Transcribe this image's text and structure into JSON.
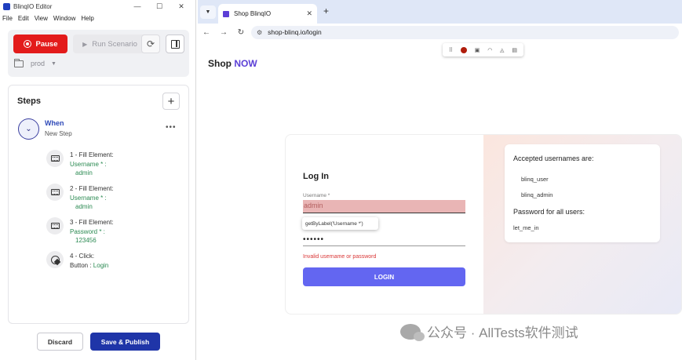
{
  "editor": {
    "title": "BlinqIO Editor",
    "window_controls": {
      "minimize": "—",
      "maximize": "☐",
      "close": "✕"
    },
    "menu": [
      "File",
      "Edit",
      "View",
      "Window",
      "Help"
    ],
    "toolbar": {
      "pause_label": "Pause",
      "run_label": "Run Scenario",
      "env_label": "prod"
    },
    "steps_title": "Steps",
    "add_step_label": "+",
    "group": {
      "keyword": "When",
      "name": "New Step",
      "more_label": "•••"
    },
    "steps": [
      {
        "line1": "1 - Fill Element:",
        "line2": "Username * :",
        "line3": "admin"
      },
      {
        "line1": "2 - Fill Element:",
        "line2": "Username * :",
        "line3": "admin"
      },
      {
        "line1": "3 - Fill Element:",
        "line2": "Password * :",
        "line3": "123456"
      },
      {
        "line1": "4 - Click:",
        "line2_prefix": "Button : ",
        "line2_value": "Login"
      }
    ],
    "footer": {
      "discard_label": "Discard",
      "save_label": "Save & Publish"
    }
  },
  "browser": {
    "tab_title": "Shop BlinqIO",
    "tab_close": "✕",
    "new_tab": "+",
    "url": "shop-blinq.io/login",
    "nav": {
      "back": "←",
      "forward": "→",
      "reload": "↻"
    },
    "recorder_icons": [
      "⠿",
      "▣",
      "◠",
      "◬",
      "▤"
    ],
    "page": {
      "brand_shop": "Shop",
      "brand_now": "NOW",
      "login_title": "Log In",
      "username_label": "Username *",
      "username_value": "admin",
      "tooltip": "getByLabel('Username *')",
      "password_value": "••••••",
      "error": "Invalid username or password",
      "login_button": "LOGIN",
      "info": {
        "heading": "Accepted usernames are:",
        "users": [
          "blinq_user",
          "blinq_admin"
        ],
        "password_heading": "Password for all users:",
        "password": "let_me_in"
      }
    }
  },
  "watermark": "公众号 · AllTests软件测试",
  "colors": {
    "pause": "#e31b1b",
    "save": "#1f35a8",
    "login_button": "#6366f1",
    "brand_accent": "#5b3fd6",
    "error": "#d93636",
    "step_value": "#2b8a52"
  }
}
